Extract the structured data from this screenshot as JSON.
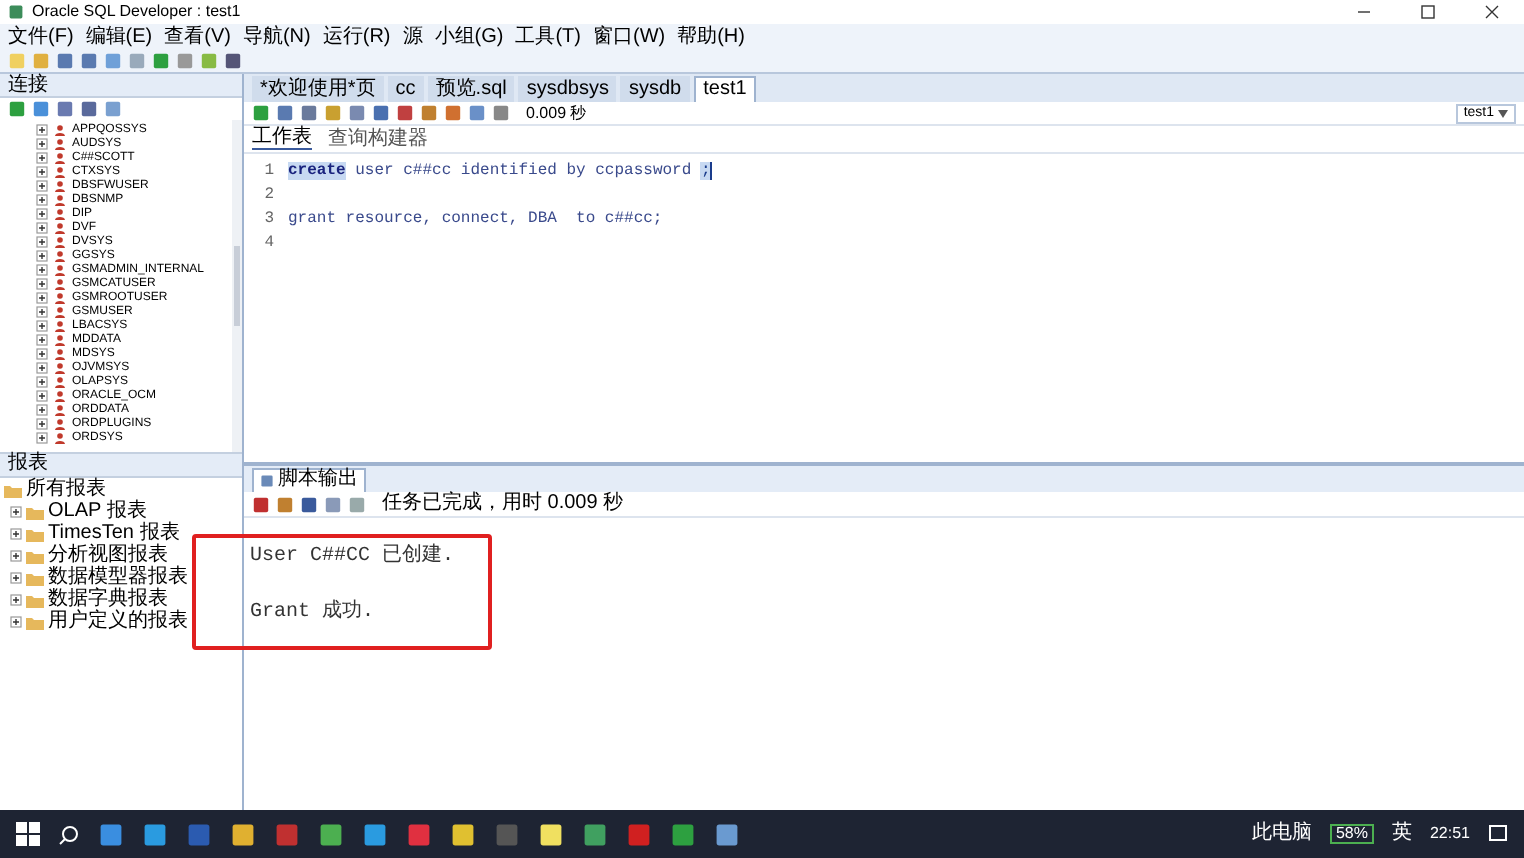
{
  "window": {
    "title": "Oracle SQL Developer : test1"
  },
  "menu": [
    "文件(F)",
    "编辑(E)",
    "查看(V)",
    "导航(N)",
    "运行(R)",
    "源",
    "小组(G)",
    "工具(T)",
    "窗口(W)",
    "帮助(H)"
  ],
  "connections": {
    "title": "连接",
    "items": [
      "APPQOSSYS",
      "AUDSYS",
      "C##SCOTT",
      "CTXSYS",
      "DBSFWUSER",
      "DBSNMP",
      "DIP",
      "DVF",
      "DVSYS",
      "GGSYS",
      "GSMADMIN_INTERNAL",
      "GSMCATUSER",
      "GSMROOTUSER",
      "GSMUSER",
      "LBACSYS",
      "MDDATA",
      "MDSYS",
      "OJVMSYS",
      "OLAPSYS",
      "ORACLE_OCM",
      "ORDDATA",
      "ORDPLUGINS",
      "ORDSYS"
    ]
  },
  "reports": {
    "title": "报表",
    "root": "所有报表",
    "children": [
      "OLAP 报表",
      "TimesTen 报表",
      "分析视图报表",
      "数据模型器报表",
      "数据字典报表",
      "用户定义的报表"
    ]
  },
  "editor_tabs": [
    {
      "label": "*欢迎使用*页",
      "selected": false
    },
    {
      "label": "cc",
      "selected": false
    },
    {
      "label": "预览.sql",
      "selected": false
    },
    {
      "label": "sysdbsys",
      "selected": false
    },
    {
      "label": "sysdb",
      "selected": false
    },
    {
      "label": "test1",
      "selected": true
    }
  ],
  "connection_select": "test1",
  "elapsed": "0.009 秒",
  "sub_tabs": [
    {
      "label": "工作表",
      "selected": true
    },
    {
      "label": "查询构建器",
      "selected": false
    }
  ],
  "code_lines": [
    {
      "number": "1",
      "tokens": [
        {
          "text": "create",
          "kind": "selected"
        },
        {
          "text": " user c##cc identified by ccpassword ",
          "kind": "code"
        },
        {
          "text": ";",
          "kind": "cursor"
        }
      ]
    },
    {
      "number": "2"
    },
    {
      "number": "3",
      "tokens": [
        {
          "text": "grant resource, connect, DBA  to c##cc;",
          "kind": "code"
        }
      ]
    },
    {
      "number": "4"
    }
  ],
  "output": {
    "tab": "脚本输出",
    "status": "任务已完成，用时 0.009 秒",
    "lines": [
      "User C##CC 已创建.",
      "Grant 成功."
    ]
  },
  "taskbar": {
    "tray_label": "此电脑",
    "battery": "58%",
    "ime": "英",
    "time": "22:51"
  }
}
